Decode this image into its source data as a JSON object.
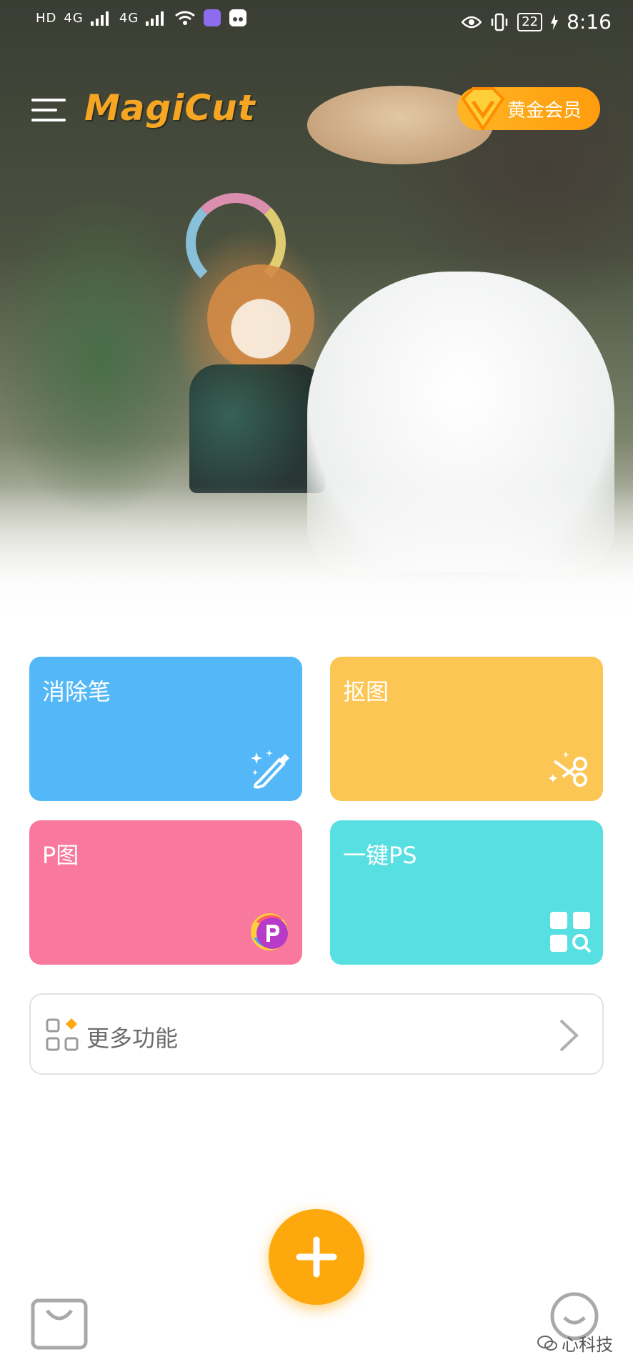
{
  "status_bar": {
    "left_labels": [
      "HD",
      "4G",
      "4G"
    ],
    "battery": "22",
    "time": "8:16"
  },
  "header": {
    "app_name": "MagiCut",
    "vip_label": "黄金会员",
    "menu_icon": "hamburger-menu-icon"
  },
  "features": [
    {
      "label": "消除笔",
      "icon": "magic-brush-icon",
      "color": "#54b8f8"
    },
    {
      "label": "抠图",
      "icon": "scissors-icon",
      "color": "#fbc654"
    },
    {
      "label": "P图",
      "icon": "p-logo-icon",
      "color": "#f8789e"
    },
    {
      "label": "一键PS",
      "icon": "grid-search-icon",
      "color": "#58dfe1"
    }
  ],
  "more": {
    "label": "更多功能",
    "icon": "apps-grid-icon",
    "arrow": "chevron-right-icon"
  },
  "bottom_bar": {
    "add_icon": "plus-icon",
    "left_icon": "shopping-bag-icon",
    "right_icon": "smile-face-icon",
    "accent_color": "#fda90d"
  },
  "watermark": {
    "text": "心科技"
  }
}
